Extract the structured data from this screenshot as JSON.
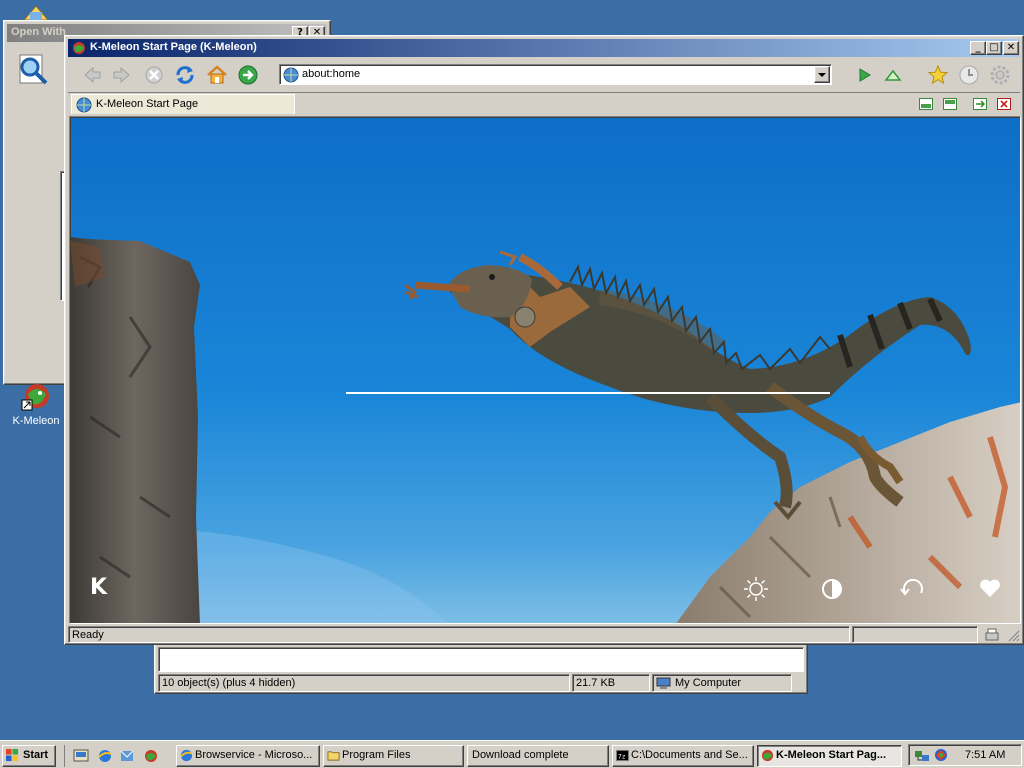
{
  "desktop": {
    "icons": [
      {
        "label": "K-Meleon"
      }
    ]
  },
  "open_with": {
    "title": "Open With",
    "help_btn": "?",
    "close_btn": "✕"
  },
  "explorer": {
    "status_objects": "10 object(s) (plus 4 hidden)",
    "status_size": "21.7 KB",
    "status_zone": "My Computer"
  },
  "browser": {
    "title": "K-Meleon Start Page (K-Meleon)",
    "address": "about:home",
    "tab_label": "K-Meleon Start Page",
    "status_text": "Ready",
    "start_page": {
      "logo_letter": "K"
    }
  },
  "taskbar": {
    "start_label": "Start",
    "tasks": [
      {
        "label": "Browservice - Microso..."
      },
      {
        "label": "Program Files"
      },
      {
        "label": "Download complete"
      },
      {
        "label": "C:\\Documents and Se..."
      },
      {
        "label": "K-Meleon Start Pag..."
      }
    ],
    "clock": "7:51 AM"
  }
}
